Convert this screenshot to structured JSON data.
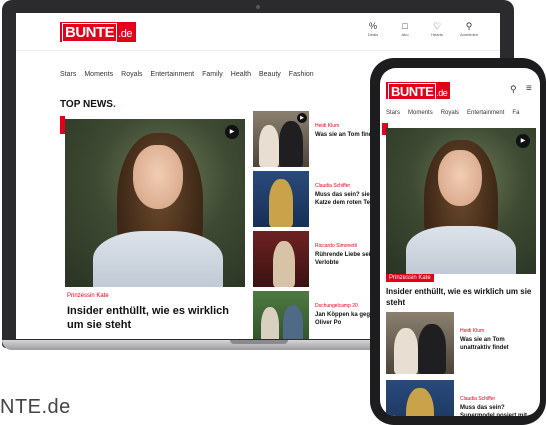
{
  "brand": {
    "logo_main": "BUNTE",
    "logo_suffix": ".de",
    "accent_color": "#e2001a"
  },
  "laptop": {
    "header_icons": [
      {
        "icon": "percent-icon",
        "glyph": "%",
        "label": "Deals"
      },
      {
        "icon": "subscription-icon",
        "glyph": "□",
        "label": "Abo"
      },
      {
        "icon": "heart-icon",
        "glyph": "♡",
        "label": "Hearts"
      },
      {
        "icon": "user-icon",
        "glyph": "⚲",
        "label": "Anmelden"
      }
    ],
    "nav": [
      "Stars",
      "Moments",
      "Royals",
      "Entertainment",
      "Family",
      "Health",
      "Beauty",
      "Fashion"
    ],
    "section_title": "TOP NEWS",
    "hero": {
      "kicker": "Prinzessin Kate",
      "headline": "Insider enthüllt, wie es wirklich um sie steht"
    },
    "side_cards": [
      {
        "kicker": "Heidi Klum",
        "title": "Was sie an Tom findet"
      },
      {
        "kicker": "Claudia Schiffer",
        "title": "Muss das sein? siert mit Katze dem roten Tepp"
      },
      {
        "kicker": "Riccardo Simonetti",
        "title": "Rührende Liebe seinen Verlobte"
      },
      {
        "kicker": "Dschungelcamp 20",
        "title": "Jan Köppen ka gegen Oliver Po"
      }
    ]
  },
  "phone": {
    "nav": [
      "Stars",
      "Moments",
      "Royals",
      "Entertainment",
      "Fa"
    ],
    "hero": {
      "kicker": "Prinzessin Kate",
      "headline": "Insider enthüllt, wie es wirklich um sie steht"
    },
    "cards": [
      {
        "kicker": "Heidi Klum",
        "title": "Was sie an Tom unattraktiv findet"
      },
      {
        "kicker": "Claudia Schiffer",
        "title": "Muss das sein? Supermodel posiert mit"
      }
    ]
  },
  "caption": "NTE.de"
}
